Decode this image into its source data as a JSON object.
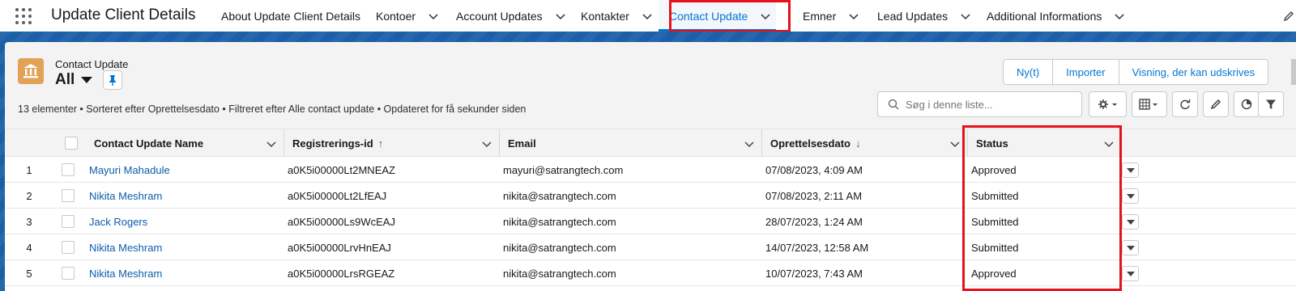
{
  "app": {
    "name": "Update Client Details"
  },
  "nav": {
    "items": [
      {
        "label": "About Update Client Details",
        "has_menu": false
      },
      {
        "label": "Kontoer",
        "has_menu": true
      },
      {
        "label": "Account Updates",
        "has_menu": true
      },
      {
        "label": "Kontakter",
        "has_menu": true
      },
      {
        "label": "Contact Update",
        "has_menu": true,
        "active": true
      },
      {
        "label": "Emner",
        "has_menu": true
      },
      {
        "label": "Lead Updates",
        "has_menu": true
      },
      {
        "label": "Additional Informations",
        "has_menu": true
      }
    ]
  },
  "header": {
    "object_label": "Contact Update",
    "list_view": "All",
    "icon": "bank-icon",
    "summary": "13 elementer • Sorteret efter Oprettelsesdato • Filtreret efter Alle contact update • Opdateret for få sekunder siden"
  },
  "actions": {
    "new": "Ny(t)",
    "import": "Importer",
    "printable": "Visning, der kan udskrives"
  },
  "search": {
    "placeholder": "Søg i denne liste...",
    "value": ""
  },
  "toolbar_icons": [
    "gear-icon",
    "table-icon",
    "refresh-icon",
    "pencil-icon",
    "pie-chart-icon",
    "filter-icon"
  ],
  "table": {
    "columns": {
      "name": "Contact Update Name",
      "reg_id": "Registrerings-id",
      "email": "Email",
      "created": "Oprettelsesdato",
      "status": "Status"
    },
    "rows": [
      {
        "num": "1",
        "name": "Mayuri Mahadule",
        "reg_id": "a0K5i00000Lt2MNEAZ",
        "email": "mayuri@satrangtech.com",
        "created": "07/08/2023, 4:09 AM",
        "status": "Approved"
      },
      {
        "num": "2",
        "name": "Nikita Meshram",
        "reg_id": "a0K5i00000Lt2LfEAJ",
        "email": "nikita@satrangtech.com",
        "created": "07/08/2023, 2:11 AM",
        "status": "Submitted"
      },
      {
        "num": "3",
        "name": "Jack Rogers",
        "reg_id": "a0K5i00000Ls9WcEAJ",
        "email": "nikita@satrangtech.com",
        "created": "28/07/2023, 1:24 AM",
        "status": "Submitted"
      },
      {
        "num": "4",
        "name": "Nikita Meshram",
        "reg_id": "a0K5i00000LrvHnEAJ",
        "email": "nikita@satrangtech.com",
        "created": "14/07/2023, 12:58 AM",
        "status": "Submitted"
      },
      {
        "num": "5",
        "name": "Nikita Meshram",
        "reg_id": "a0K5i00000LrsRGEAZ",
        "email": "nikita@satrangtech.com",
        "created": "10/07/2023, 7:43 AM",
        "status": "Approved"
      }
    ]
  },
  "colors": {
    "accent": "#0176d3",
    "highlight": "#e8101a",
    "band": "#1b5fa8",
    "object_icon": "#e3a156"
  }
}
